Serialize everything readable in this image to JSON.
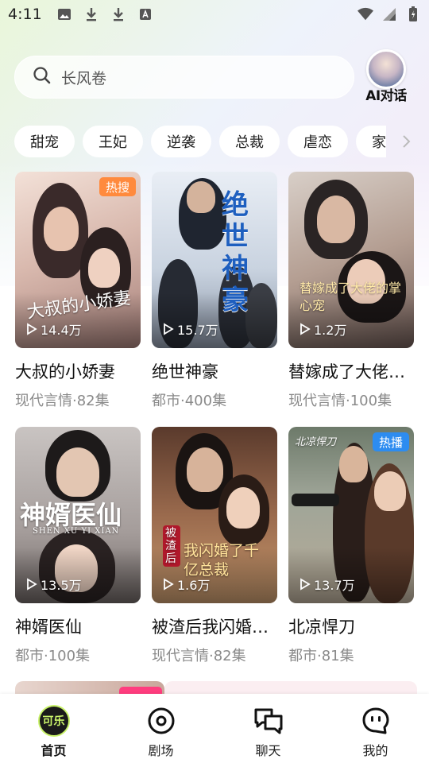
{
  "status_bar": {
    "time": "4:11"
  },
  "search": {
    "placeholder": "长风卷"
  },
  "ai_chat": {
    "label": "AI对话"
  },
  "categories": [
    "甜宠",
    "王妃",
    "逆袭",
    "总裁",
    "虐恋",
    "家"
  ],
  "dramas": [
    {
      "title": "大叔的小娇妻",
      "meta": "现代言情·82集",
      "views": "14.4万",
      "badge": "热搜",
      "badge_type": "hot",
      "cover_text": "大叔的小娇妻"
    },
    {
      "title": "绝世神豪",
      "meta": "都市·400集",
      "views": "15.7万",
      "badge": "",
      "cover_text": "绝世神豪"
    },
    {
      "title": "替嫁成了大佬的掌心宠",
      "meta": "现代言情·100集",
      "views": "1.2万",
      "badge": "",
      "cover_text": "替嫁成了大佬的掌心宠"
    },
    {
      "title": "神婿医仙",
      "meta": "都市·100集",
      "views": "13.5万",
      "badge": "",
      "cover_text": "神婿医仙",
      "cover_subtext": "SHEN XU YI XIAN"
    },
    {
      "title": "被渣后我闪婚了千亿总裁",
      "meta": "现代言情·82集",
      "views": "1.6万",
      "badge": "",
      "cover_text": "我闪婚了千亿总裁",
      "cover_tag": "被渣后"
    },
    {
      "title": "北凉悍刀",
      "meta": "都市·81集",
      "views": "13.7万",
      "badge": "热播",
      "badge_type": "play",
      "cover_text": "北凉悍刀"
    }
  ],
  "nav": [
    {
      "label": "首页",
      "logo_text": "可乐"
    },
    {
      "label": "剧场"
    },
    {
      "label": "聊天"
    },
    {
      "label": "我的"
    }
  ],
  "colors": {
    "hot_badge": "#ff8a3d",
    "play_badge": "#2d8cf0",
    "accent": "#c9f36a"
  }
}
